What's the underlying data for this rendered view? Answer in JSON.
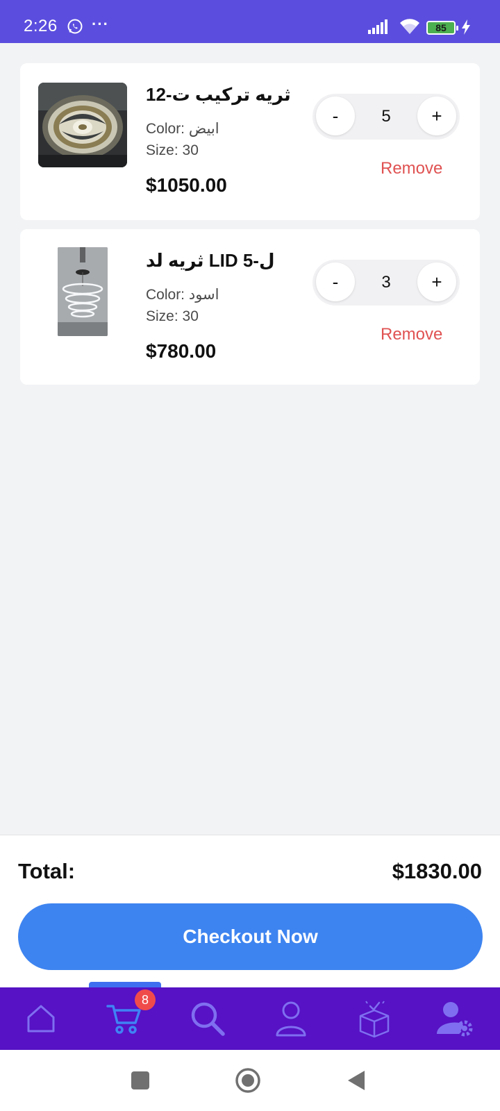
{
  "status_bar": {
    "time": "2:26",
    "dots": "···",
    "battery": "85",
    "icons": [
      "whatsapp-icon",
      "signal-icon",
      "wifi-icon",
      "battery-icon",
      "charging-icon"
    ]
  },
  "cart": {
    "items": [
      {
        "name": "ثريه تركيب ت-12",
        "color": "Color: ابيض",
        "size": "Size: 30",
        "price": "$1050.00",
        "qty": "5",
        "minus": "-",
        "plus": "+",
        "remove": "Remove"
      },
      {
        "name": "ثريه لد LID ل-5",
        "color": "Color: اسود",
        "size": "Size: 30",
        "price": "$780.00",
        "qty": "3",
        "minus": "-",
        "plus": "+",
        "remove": "Remove"
      }
    ]
  },
  "footer": {
    "total_label": "Total:",
    "total_value": "$1830.00",
    "checkout_label": "Checkout Now"
  },
  "bottom_nav": {
    "cart_badge": "8",
    "items": [
      "home-icon",
      "cart-icon",
      "search-icon",
      "profile-icon",
      "orders-icon",
      "account-settings-icon"
    ],
    "active": "cart-icon"
  },
  "colors": {
    "status_bar": "#5b4ede",
    "bottom_nav": "#5612c4",
    "accent": "#3e84f0",
    "remove": "#e05252",
    "badge": "#f04b4b"
  }
}
